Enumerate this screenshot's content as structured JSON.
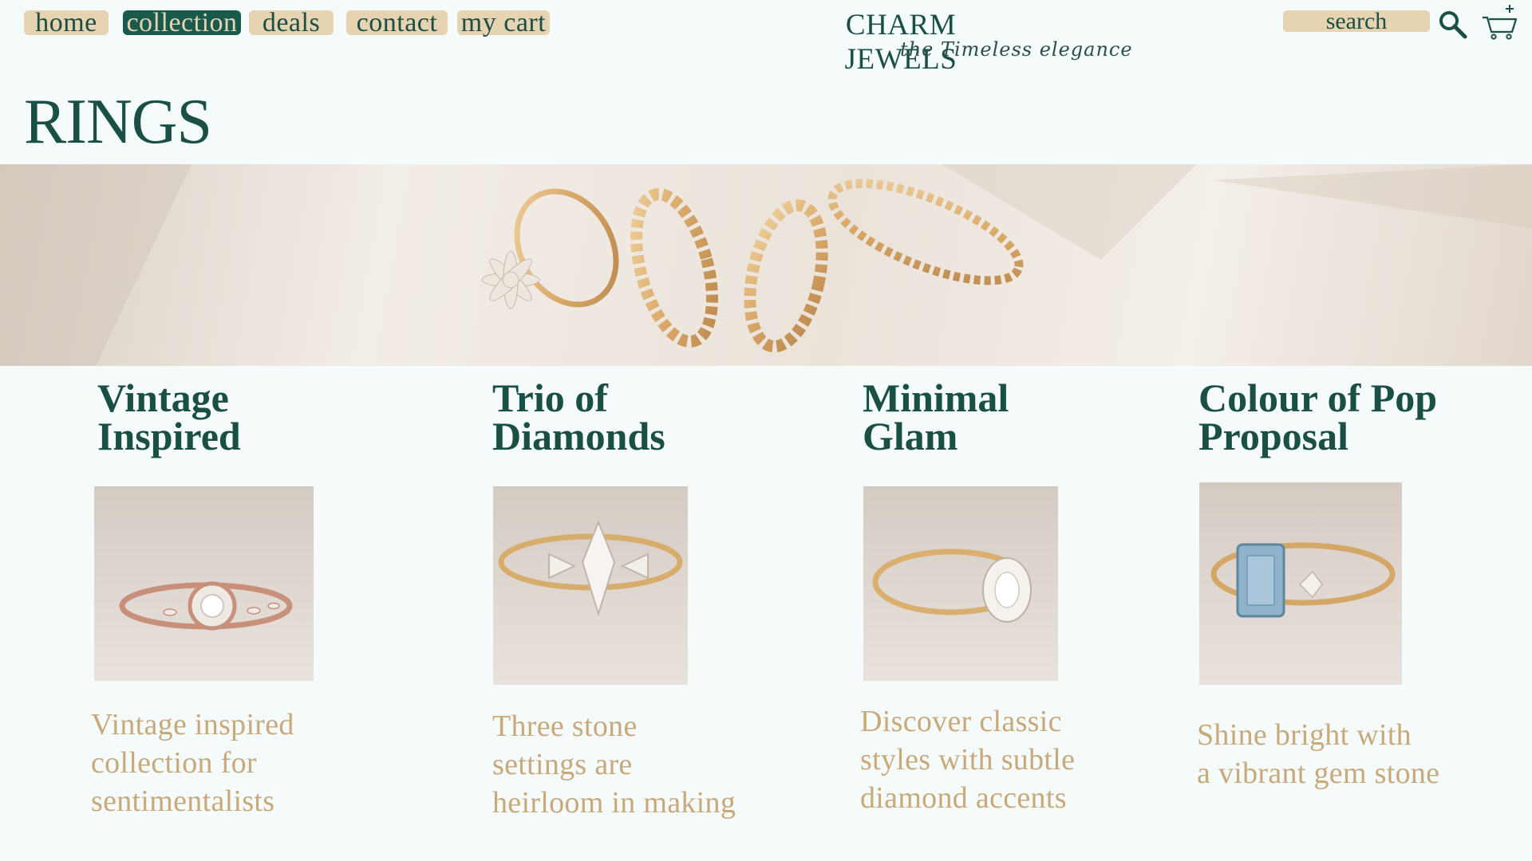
{
  "nav": {
    "items": [
      {
        "label": "home"
      },
      {
        "label": "collection"
      },
      {
        "label": "deals"
      },
      {
        "label": "contact"
      },
      {
        "label": "my cart"
      }
    ],
    "active_item": "collection"
  },
  "brand": {
    "name": "CHARM JEWELS",
    "tagline": "the Timeless elegance"
  },
  "search": {
    "placeholder": "search"
  },
  "icons": {
    "search": "search-icon",
    "cart": "cart-add-icon"
  },
  "page": {
    "title": "RINGS"
  },
  "categories": [
    {
      "title": "Vintage\nInspired",
      "description": "Vintage inspired\ncollection for\nsentimentalists",
      "image": "rose-gold-halo-ring"
    },
    {
      "title": "Trio of\nDiamonds",
      "description": "Three stone\nsettings are\nheirloom in making",
      "image": "marquise-three-stone-ring"
    },
    {
      "title": "Minimal\nGlam",
      "description": "Discover classic\nstyles with subtle\ndiamond accents",
      "image": "oval-solitaire-ring"
    },
    {
      "title": "Colour of Pop\nProposal",
      "description": "Shine bright with\na vibrant gem stone",
      "image": "aquamarine-emerald-cut-ring"
    }
  ],
  "colors": {
    "primary": "#1a4f45",
    "accent": "#e6d3b1",
    "text_gold": "#c8a97a",
    "background": "#f5fafa"
  }
}
